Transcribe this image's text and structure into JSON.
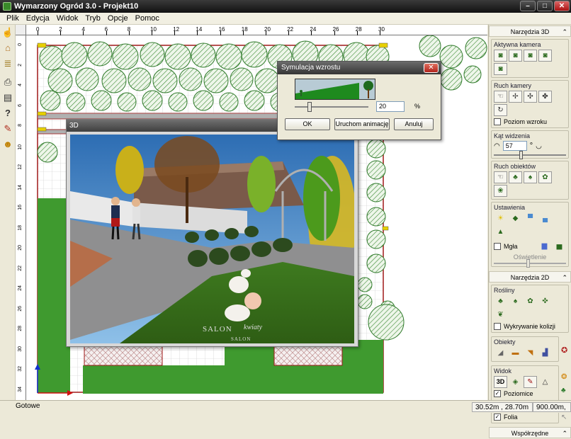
{
  "window": {
    "title": "Wymarzony Ogród 3.0 - Projekt10",
    "btn_min": "–",
    "btn_max": "□",
    "btn_close": "✕"
  },
  "menu": [
    "Plik",
    "Edycja",
    "Widok",
    "Tryb",
    "Opcje",
    "Pomoc"
  ],
  "ruler": {
    "top": [
      "0",
      "2",
      "4",
      "6",
      "8",
      "10",
      "12",
      "14",
      "16",
      "18",
      "20",
      "22",
      "24",
      "26",
      "28",
      "30"
    ],
    "left": [
      "0",
      "2",
      "4",
      "6",
      "8",
      "10",
      "12",
      "14",
      "16",
      "18",
      "20",
      "22",
      "24",
      "26",
      "28",
      "30",
      "32",
      "34"
    ]
  },
  "window3d": {
    "title": "3D",
    "watermark_a": "SALON",
    "watermark_b": "kwiaty",
    "watermark_c": "SALON"
  },
  "dialog": {
    "title": "Symulacja wzrostu",
    "value": "20",
    "unit": "%",
    "growth_percent": 20,
    "ok": "OK",
    "animate": "Uruchom animację",
    "cancel": "Anuluj",
    "close": "✕"
  },
  "panel": {
    "tools3d": "Narzędzia 3D",
    "camera": "Aktywna kamera",
    "camera_move": "Ruch kamery",
    "eye_level": "Poziom wzroku",
    "fov": "Kąt widzenia",
    "fov_value": "57",
    "fov_unit": "°",
    "object_move": "Ruch obiektów",
    "settings": "Ustawienia",
    "fog": "Mgła",
    "lighting": "Oświetlenie",
    "tools2d": "Narzędzia 2D",
    "plants": "Rośliny",
    "collision": "Wykrywanie kolizji",
    "objects": "Obiekty",
    "view": "Widok",
    "view_3d": "3D",
    "levels": "Poziomice",
    "foil": "Folia",
    "coords": "Współrzędne",
    "chevron": "⌃"
  },
  "status": {
    "ready": "Gotowe",
    "coords": "30.52m , 28.70m",
    "zoom": "900.00m,"
  },
  "colors": {
    "grass": "#3f9a2f",
    "hedge": "#cfe5c4",
    "hedge_stroke": "#2f7a2a",
    "accent_red": "#b02020"
  }
}
